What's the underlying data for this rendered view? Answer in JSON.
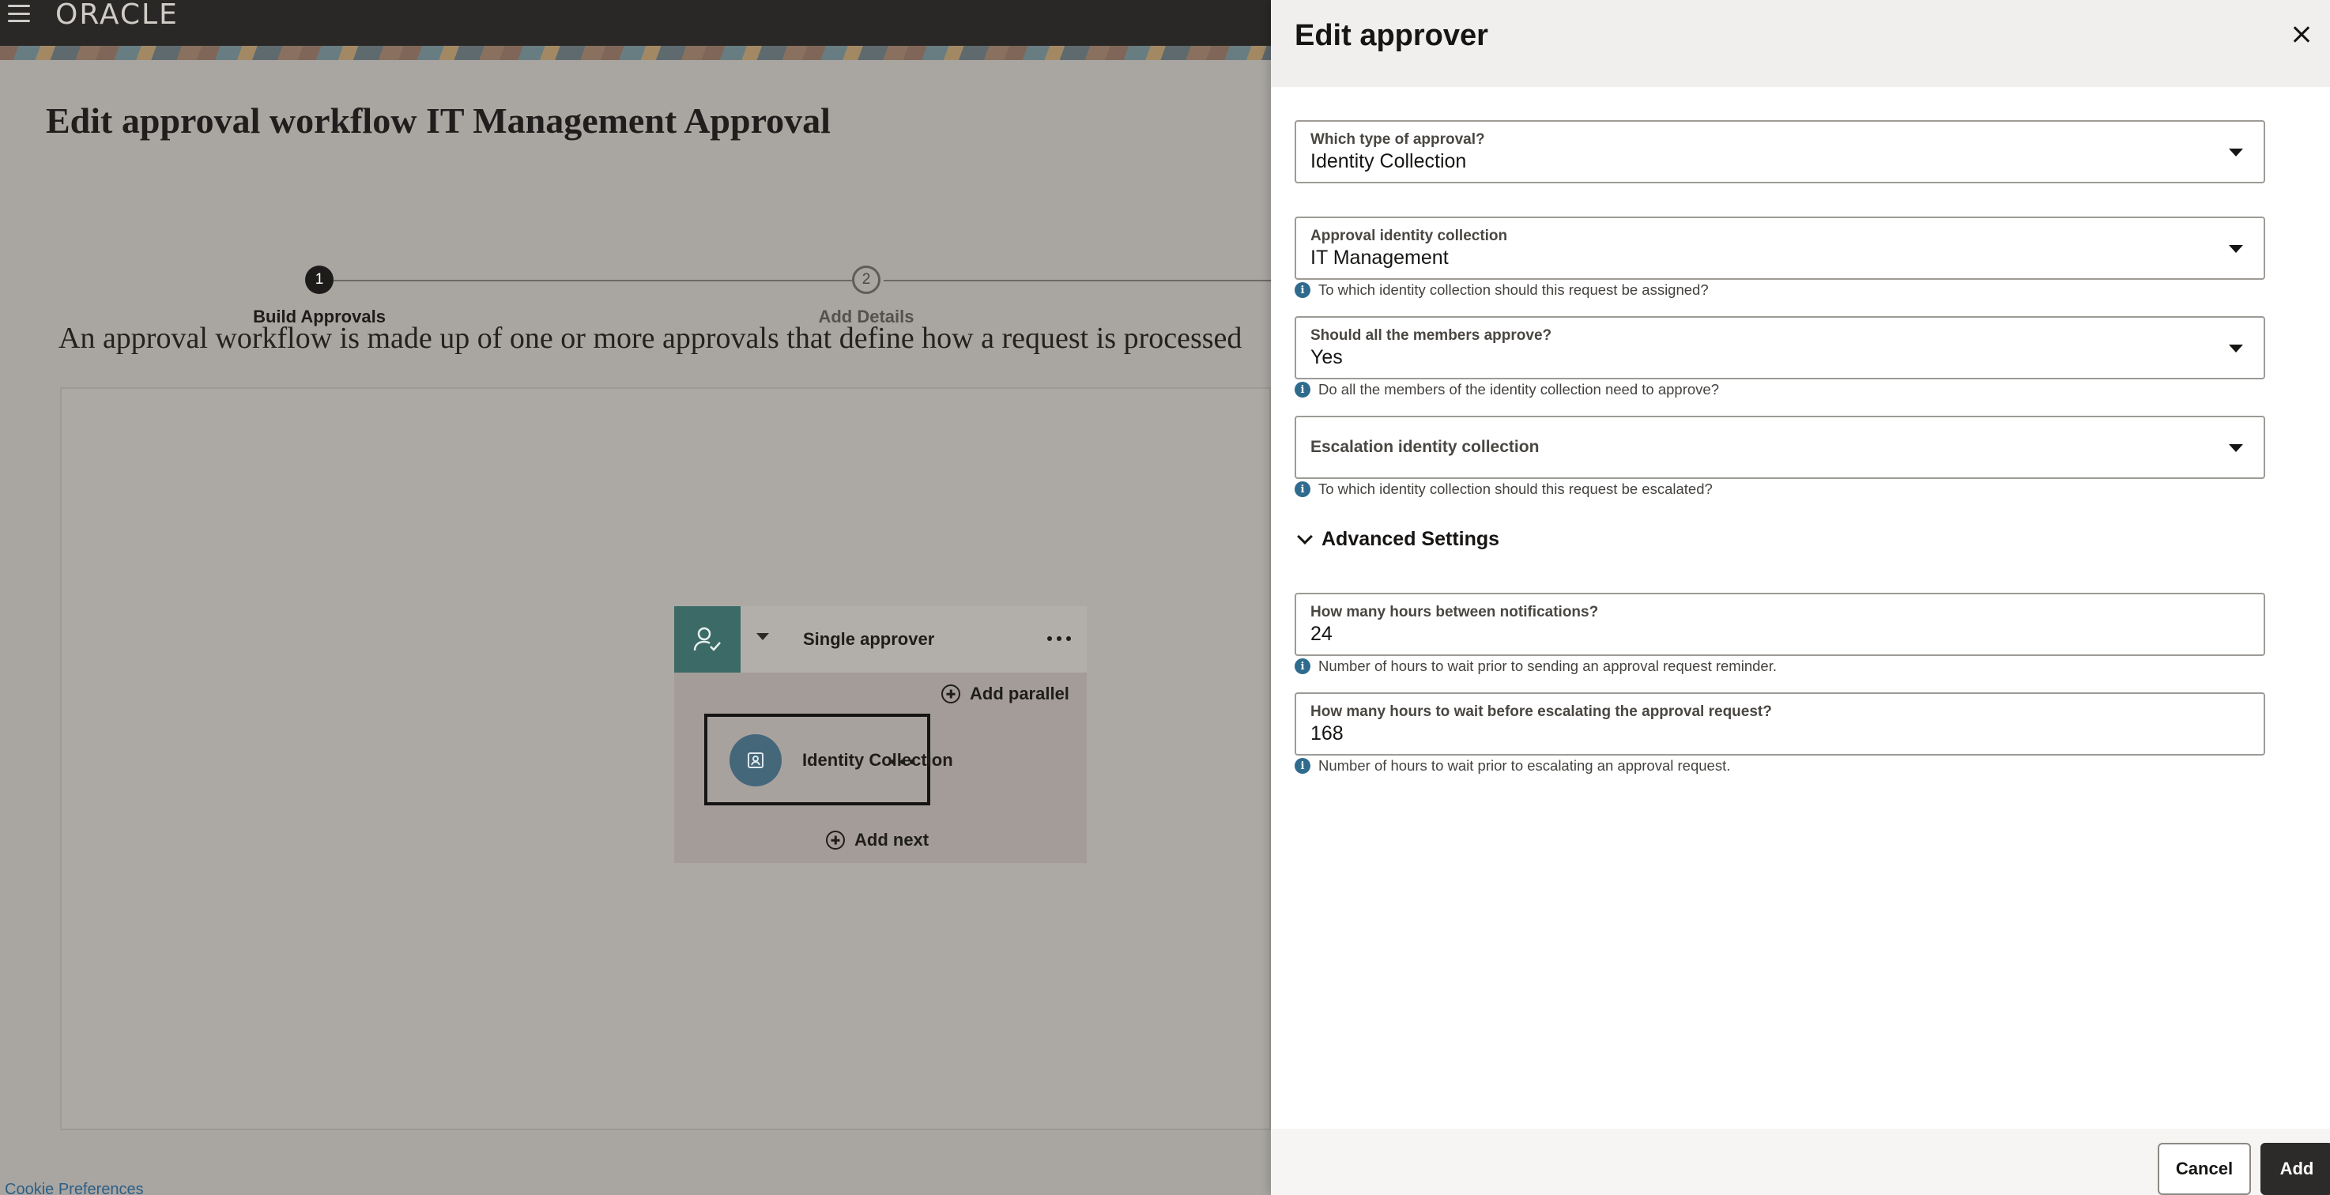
{
  "header": {
    "brand": "ORACLE"
  },
  "page": {
    "title_prefix": "Edit approval workflow ",
    "title_name": "IT Management Approval",
    "intro": "An approval workflow is made up of one or more approvals that define how a request is processed"
  },
  "train": {
    "steps": [
      {
        "number": "1",
        "label": "Build Approvals",
        "state": "active"
      },
      {
        "number": "2",
        "label": "Add Details",
        "state": "todo"
      }
    ]
  },
  "flow": {
    "node_title": "Single approver",
    "add_parallel": "Add parallel",
    "approval_item": "Identity Collection",
    "add_next": "Add next"
  },
  "footer": {
    "cookie": "Cookie Preferences"
  },
  "drawer": {
    "title": "Edit approver",
    "fields": {
      "approval_type": {
        "label": "Which type of approval?",
        "value": "Identity Collection"
      },
      "identity_collection": {
        "label": "Approval identity collection",
        "value": "IT Management",
        "help": "To which identity collection should this request be assigned?"
      },
      "all_members": {
        "label": "Should all the members approve?",
        "value": "Yes",
        "help": "Do all the members of the identity collection need to approve?"
      },
      "escalation": {
        "label": "Escalation identity collection",
        "value": "",
        "help": "To which identity collection should this request be escalated?"
      },
      "notif_hours": {
        "label": "How many hours between notifications?",
        "value": "24",
        "help": "Number of hours to wait prior to sending an approval request reminder."
      },
      "escalate_hours": {
        "label": "How many hours to wait before escalating the approval request?",
        "value": "168",
        "help": "Number of hours to wait prior to escalating an approval request."
      }
    },
    "advanced_settings": "Advanced Settings",
    "buttons": {
      "cancel": "Cancel",
      "add": "Add"
    }
  },
  "icons": [
    "menu-icon",
    "close-icon",
    "chevron-down-icon",
    "info-icon",
    "add-circle-icon",
    "user-check-icon",
    "identity-collection-icon",
    "more-icon"
  ],
  "colors": {
    "primary_dark": "#2d2b29",
    "info": "#2f6b8d",
    "link": "#2d5f86",
    "approver_avatar": "#3c6a66"
  }
}
